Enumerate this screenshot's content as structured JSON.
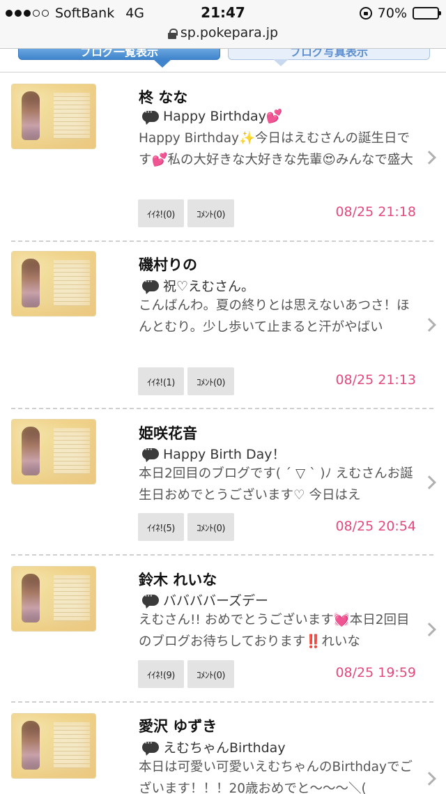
{
  "status_bar": {
    "carrier": "SoftBank",
    "network": "4G",
    "time": "21:47",
    "battery": "70%",
    "battery_level": 0.7,
    "signal_bars_filled": 3,
    "signal_bars_total": 5
  },
  "browser": {
    "url": "sp.pokepara.jp"
  },
  "tabs": [
    {
      "label": "ブログ一覧表示",
      "active": true
    },
    {
      "label": "ブログ写真表示",
      "active": false
    }
  ],
  "accent_colors": {
    "date": "#e24a7d",
    "tab_active": "#3f84cc"
  },
  "posts": [
    {
      "name": "柊 なな",
      "title": "Happy Birthday💕",
      "excerpt": "Happy Birthday✨今日はえむさんの誕生日です💕私の大好きな大好きな先輩😍みんなで盛大",
      "like_label": "ｲｲﾈ!(0)",
      "comment_label": "ｺﾒﾝﾄ(0)",
      "date": "08/25 21:18"
    },
    {
      "name": "磯村りの",
      "title": "祝♡えむさん。",
      "excerpt": "こんばんわ。夏の終りとは思えないあつさ！ほんとむり。少し歩いて止まると汗がやばい",
      "like_label": "ｲｲﾈ!(1)",
      "comment_label": "ｺﾒﾝﾄ(0)",
      "date": "08/25 21:13"
    },
    {
      "name": "姫咲花音",
      "title": "Happy Birth Day！",
      "excerpt": "本日2回目のブログです( ´ ▽ ` )ﾉ えむさんお誕生日おめでとうございます♡ 今日はえ",
      "like_label": "ｲｲﾈ!(5)",
      "comment_label": "ｺﾒﾝﾄ(0)",
      "date": "08/25 20:54"
    },
    {
      "name": "鈴木 れいな",
      "title": "ババババーズデー",
      "excerpt": "えむさん!! おめでとうございます💓本日2回目のブログお待ちしております‼️れいな",
      "like_label": "ｲｲﾈ!(9)",
      "comment_label": "ｺﾒﾝﾄ(0)",
      "date": "08/25 19:59"
    },
    {
      "name": "愛沢 ゆずき",
      "title": "えむちゃんBirthday",
      "excerpt": "本日は可愛い可愛いえむちゃんのBirthdayでございます！！！20歳おめでと～～～＼(",
      "like_label": "",
      "comment_label": "",
      "date": ""
    }
  ]
}
